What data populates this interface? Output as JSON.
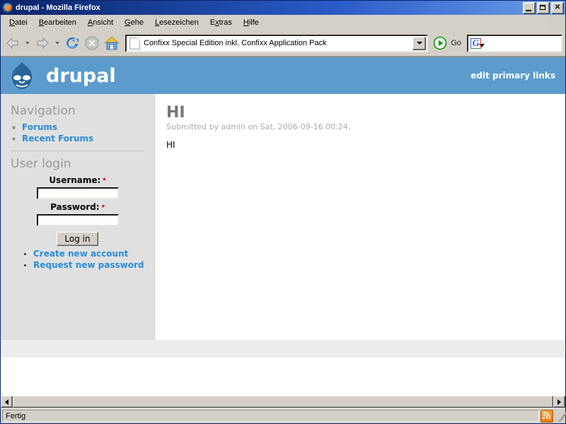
{
  "window": {
    "title": "drupal - Mozilla Firefox",
    "icon": "firefox-icon",
    "controls": {
      "minimize": "_",
      "maximize": "□",
      "close": "✕"
    }
  },
  "menubar": {
    "items": [
      {
        "label": "Datei",
        "accel": "D"
      },
      {
        "label": "Bearbeiten",
        "accel": "B"
      },
      {
        "label": "Ansicht",
        "accel": "A"
      },
      {
        "label": "Gehe",
        "accel": "G"
      },
      {
        "label": "Lesezeichen",
        "accel": "L"
      },
      {
        "label": "Extras",
        "accel": "x"
      },
      {
        "label": "Hilfe",
        "accel": "H"
      }
    ]
  },
  "toolbar": {
    "back_icon": "back-arrow-icon",
    "forward_icon": "forward-arrow-icon",
    "reload_icon": "reload-icon",
    "stop_icon": "stop-icon",
    "home_icon": "home-icon",
    "url_value": "Confixx Special Edition inkl. Confixx Application Pack",
    "url_icon": "page-icon",
    "go_label": "Go",
    "go_icon": "go-arrow-icon",
    "search_engine": "G",
    "search_value": ""
  },
  "site": {
    "banner": {
      "logo": "drupal-druplicon-logo",
      "name": "drupal",
      "primary_link": "edit primary links",
      "color": "#5c9ccc"
    },
    "sidebar": {
      "navigation": {
        "title": "Navigation",
        "links": [
          {
            "label": "Forums"
          },
          {
            "label": "Recent Forums"
          }
        ]
      },
      "user_login": {
        "title": "User login",
        "username_label": "Username:",
        "username_required": "*",
        "username_value": "",
        "password_label": "Password:",
        "password_required": "*",
        "password_value": "",
        "submit_label": "Log in",
        "links": [
          {
            "label": "Create new account"
          },
          {
            "label": "Request new password"
          }
        ]
      }
    },
    "content": {
      "node_title": "HI",
      "submitted": "Submitted by admin on Sat, 2006-09-16 00:24.",
      "body": "HI"
    }
  },
  "statusbar": {
    "text": "Fertig",
    "rss_icon": "rss-feed-icon",
    "grip_icon": "resize-grip-icon"
  }
}
